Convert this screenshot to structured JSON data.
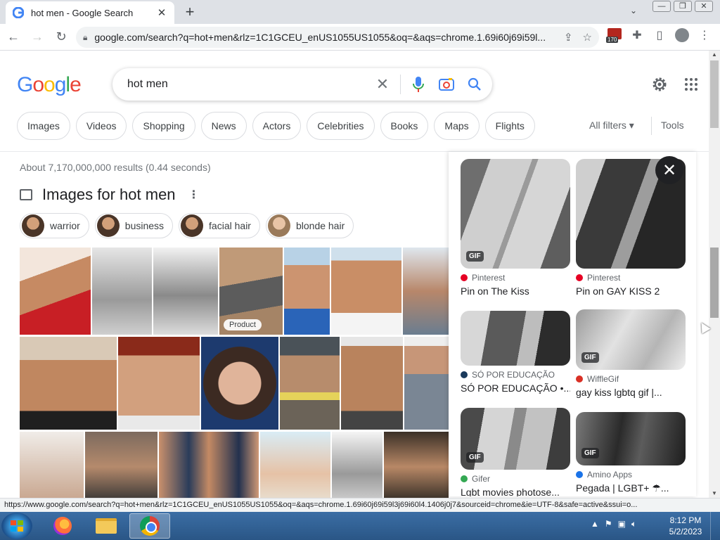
{
  "browser": {
    "tab_title": "hot men - Google Search",
    "tab_close": "✕",
    "new_tab": "+",
    "url": "google.com/search?q=hot+men&rlz=1C1GCEU_enUS1055US1055&oq=&aqs=chrome.1.69i60j69i59l...",
    "extension_badge": "170",
    "window_buttons": [
      "—",
      "❐",
      "✕"
    ]
  },
  "google": {
    "logo_letters": [
      {
        "ch": "G",
        "color": "#4285F4"
      },
      {
        "ch": "o",
        "color": "#EA4335"
      },
      {
        "ch": "o",
        "color": "#FBBC05"
      },
      {
        "ch": "g",
        "color": "#4285F4"
      },
      {
        "ch": "l",
        "color": "#34A853"
      },
      {
        "ch": "e",
        "color": "#EA4335"
      }
    ],
    "query": "hot men",
    "clear": "✕",
    "chips": [
      "Images",
      "Videos",
      "Shopping",
      "News",
      "Actors",
      "Celebrities",
      "Books",
      "Maps",
      "Flights"
    ],
    "all_filters": "All filters ▾",
    "tools": "Tools"
  },
  "results": {
    "stats": "About 7,170,000,000 results (0.44 seconds)",
    "images_title": "Images for hot men",
    "more_icon": "⋮",
    "refine_chips": [
      "warrior",
      "business",
      "facial hair",
      "blonde hair"
    ],
    "product_label": "Product"
  },
  "panel": {
    "close": "✕",
    "gif_label": "GIF",
    "cards": [
      {
        "source": "Pinterest",
        "title": "Pin on The Kiss",
        "src_color": "#e60023",
        "gif": true
      },
      {
        "source": "Pinterest",
        "title": "Pin on GAY KISS 2",
        "src_color": "#e60023",
        "gif": false
      },
      {
        "source": "SÓ POR EDUCAÇÃO",
        "title": "SÓ POR EDUCAÇÃO •...",
        "src_color": "#1a3a5c",
        "gif": false
      },
      {
        "source": "WiffleGif",
        "title": "gay kiss lgbtq gif |...",
        "src_color": "#d93025",
        "gif": true
      },
      {
        "source": "Gifer",
        "title": "Lgbt movies photose...",
        "src_color": "#34a853",
        "gif": true
      },
      {
        "source": "Amino Apps",
        "title": "Pegada | LGBT+ ☂...",
        "src_color": "#1a73e8",
        "gif": true
      }
    ]
  },
  "status_url": "https://www.google.com/search?q=hot+men&rlz=1C1GCEU_enUS1055US1055&oq=&aqs=chrome.1.69i60j69i59l3j69i60l4.1406j0j7&sourceid=chrome&ie=UTF-8&safe=active&ssui=o...",
  "taskbar": {
    "time": "8:12 PM",
    "date": "5/2/2023"
  }
}
